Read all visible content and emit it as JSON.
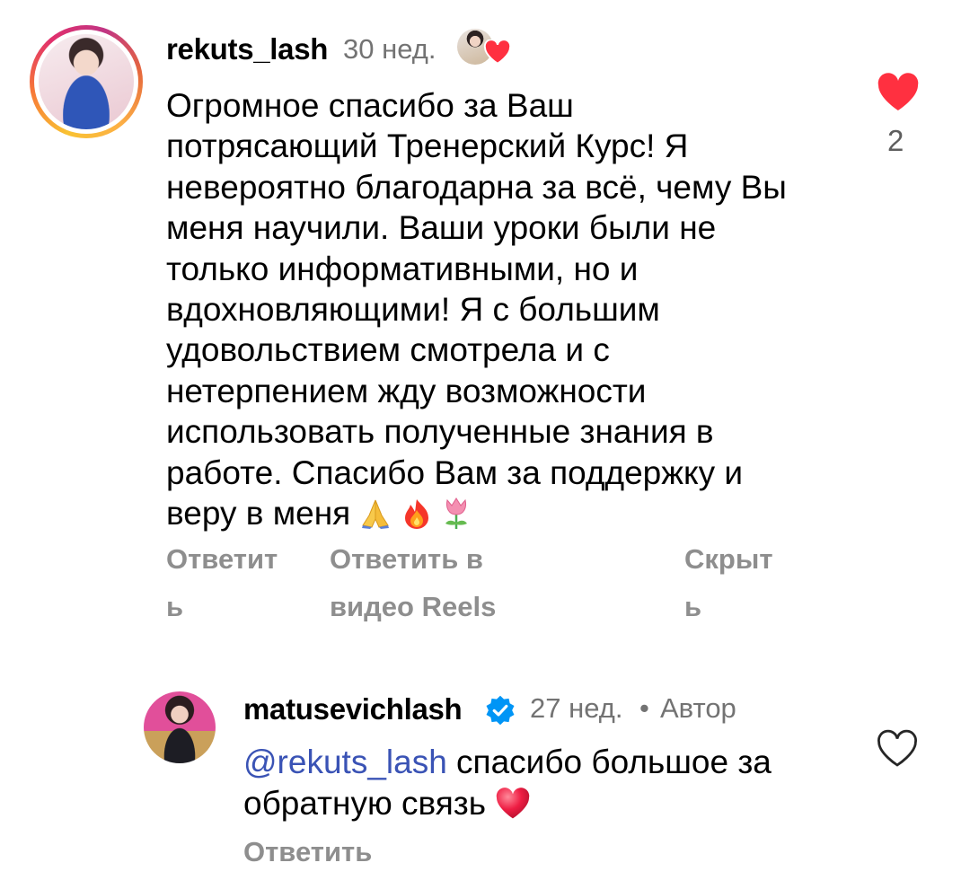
{
  "comment": {
    "username": "rekuts_lash",
    "time": "30 нед.",
    "lines": [
      "Огромное спасибо за Ваш",
      "потрясающий Тренерский Курс!  Я",
      "невероятно благодарна за всё, чему Вы",
      "меня научили.  Ваши уроки были не",
      "только информативными, но и",
      "вдохновляющими! Я с большим",
      "удовольствием смотрела и с",
      "нетерпением жду возможности",
      "использовать полученные знания в",
      "работе.  Спасибо Вам за поддержку и",
      "веру в меня"
    ],
    "emojis": [
      "praying-hands",
      "fire",
      "tulip"
    ],
    "like_count": "2",
    "liked": true,
    "actions": {
      "reply_line1": "Ответит",
      "reply_line2": "ь",
      "reels_line1": "Ответить в",
      "reels_line2": "видео Reels",
      "hide_line1": "Скрыт",
      "hide_line2": "ь"
    }
  },
  "reply": {
    "username": "matusevichlash",
    "verified": true,
    "time": "27 нед.",
    "separator": "•",
    "author_label": "Автор",
    "mention": "@rekuts_lash",
    "text_part1": " спасибо большое за",
    "text_part2": "обратную связь",
    "emoji": "red-heart",
    "reply_action": "Ответить"
  },
  "colors": {
    "like_red": "#ff3040",
    "meta_gray": "#737373",
    "action_gray": "#8e8e8e",
    "mention_blue": "#3a53b5",
    "verified_blue": "#0095f6"
  }
}
